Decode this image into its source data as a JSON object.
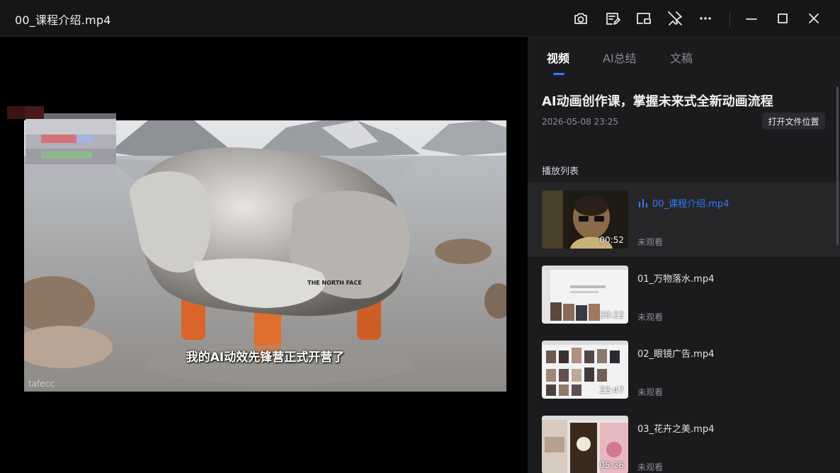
{
  "window": {
    "title": "00_课程介绍.mp4",
    "icons": [
      "camera-icon",
      "edit-note-icon",
      "picture-in-picture-icon",
      "pin-off-icon",
      "more-icon",
      "minimize-icon",
      "maximize-icon",
      "close-icon"
    ]
  },
  "player": {
    "subtitle": "我的AI动效先锋营正式开营了",
    "watermark": "tafecc",
    "logo_text": "THE NORTH FACE"
  },
  "sidebar": {
    "tabs": [
      {
        "label": "视频",
        "active": true
      },
      {
        "label": "AI总结",
        "active": false
      },
      {
        "label": "文稿",
        "active": false
      }
    ],
    "course_title": "AI动画创作课，掌握未来式全新动画流程",
    "course_date": "2026-05-08 23:25",
    "open_folder_label": "打开文件位置",
    "playlist_label": "播放列表",
    "playlist": [
      {
        "name": "00_课程介绍.mp4",
        "duration": "00:52",
        "status": "未观看",
        "active": true
      },
      {
        "name": "01_万物落水.mp4",
        "duration": "20:22",
        "status": "未观看",
        "active": false
      },
      {
        "name": "02_眼镜广告.mp4",
        "duration": "22:47",
        "status": "未观看",
        "active": false
      },
      {
        "name": "03_花卉之美.mp4",
        "duration": "05:26",
        "status": "未观看",
        "active": false
      }
    ]
  },
  "colors": {
    "accent": "#2e7bff",
    "sidebar_bg": "#1b1b1e",
    "titlebar_bg": "#161618"
  }
}
